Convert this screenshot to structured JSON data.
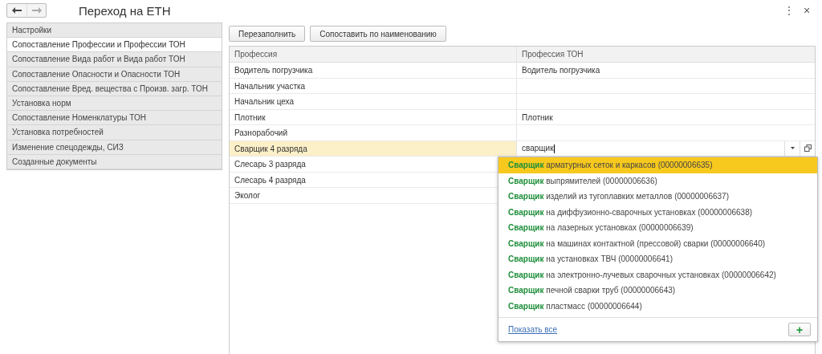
{
  "window": {
    "title": "Переход на ЕТН",
    "menu_glyph": "⋮",
    "close_glyph": "×"
  },
  "sidebar": {
    "items": [
      {
        "label": "Настройки",
        "selected": false
      },
      {
        "label": "Сопоставление Профессии и Профессии ТОН",
        "selected": true
      },
      {
        "label": "Сопоставление Вида работ и Вида работ ТОН",
        "selected": false
      },
      {
        "label": "Сопоставление Опасности и Опасности ТОН",
        "selected": false
      },
      {
        "label": "Сопоставление Вред. вещества с Произв. загр. ТОН",
        "selected": false
      },
      {
        "label": "Установка норм",
        "selected": false
      },
      {
        "label": "Сопоставление Номенклатуры ТОН",
        "selected": false
      },
      {
        "label": "Установка потребностей",
        "selected": false
      },
      {
        "label": "Изменение спецодежды, СИЗ",
        "selected": false
      },
      {
        "label": "Созданные документы",
        "selected": false
      }
    ]
  },
  "toolbar": {
    "buttons": [
      "Перезаполнить",
      "Сопоставить по наименованию"
    ]
  },
  "table": {
    "columns": [
      "Профессия",
      "Профессия ТОН"
    ],
    "rows": [
      {
        "profession": "Водитель погрузчика",
        "ton": "Водитель погрузчика",
        "selected": false
      },
      {
        "profession": "Начальник участка",
        "selected": false
      },
      {
        "profession": "Начальник цеха",
        "selected": false
      },
      {
        "profession": "Плотник",
        "ton": "Плотник",
        "selected": false
      },
      {
        "profession": "Разнорабочий",
        "selected": false
      },
      {
        "profession": "Сварщик 4 разряда",
        "ton": "сварщик",
        "selected": true
      },
      {
        "profession": "Слесарь 3 разряда",
        "selected": false
      },
      {
        "profession": "Слесарь 4 разряда",
        "selected": false
      },
      {
        "profession": "Эколог",
        "selected": false
      }
    ]
  },
  "dropdown": {
    "items": [
      {
        "text": "**Сварщик** арматурных сеток и каркасов (00000006635)",
        "selected": true
      },
      {
        "text": "**Сварщик** выпрямителей (00000006636)",
        "selected": false
      },
      {
        "text": "**Сварщик** изделий из тугоплавких металлов (00000006637)",
        "selected": false
      },
      {
        "text": "**Сварщик** на диффузионно-сварочных установках (00000006638)",
        "selected": false
      },
      {
        "text": "**Сварщик** на лазерных установках (00000006639)",
        "selected": false
      },
      {
        "text": "**Сварщик** на машинах контактной (прессовой) сварки (00000006640)",
        "selected": false
      },
      {
        "text": "**Сварщик** на установках ТВЧ (00000006641)",
        "selected": false
      },
      {
        "text": "**Сварщик** на электронно-лучевых сварочных установках (00000006642)",
        "selected": false
      },
      {
        "text": "**Сварщик** печной сварки труб (00000006643)",
        "selected": false
      },
      {
        "text": "**Сварщик** пластмасс (00000006644)",
        "selected": false
      }
    ],
    "show_all": "Показать все",
    "add_glyph": "+"
  }
}
